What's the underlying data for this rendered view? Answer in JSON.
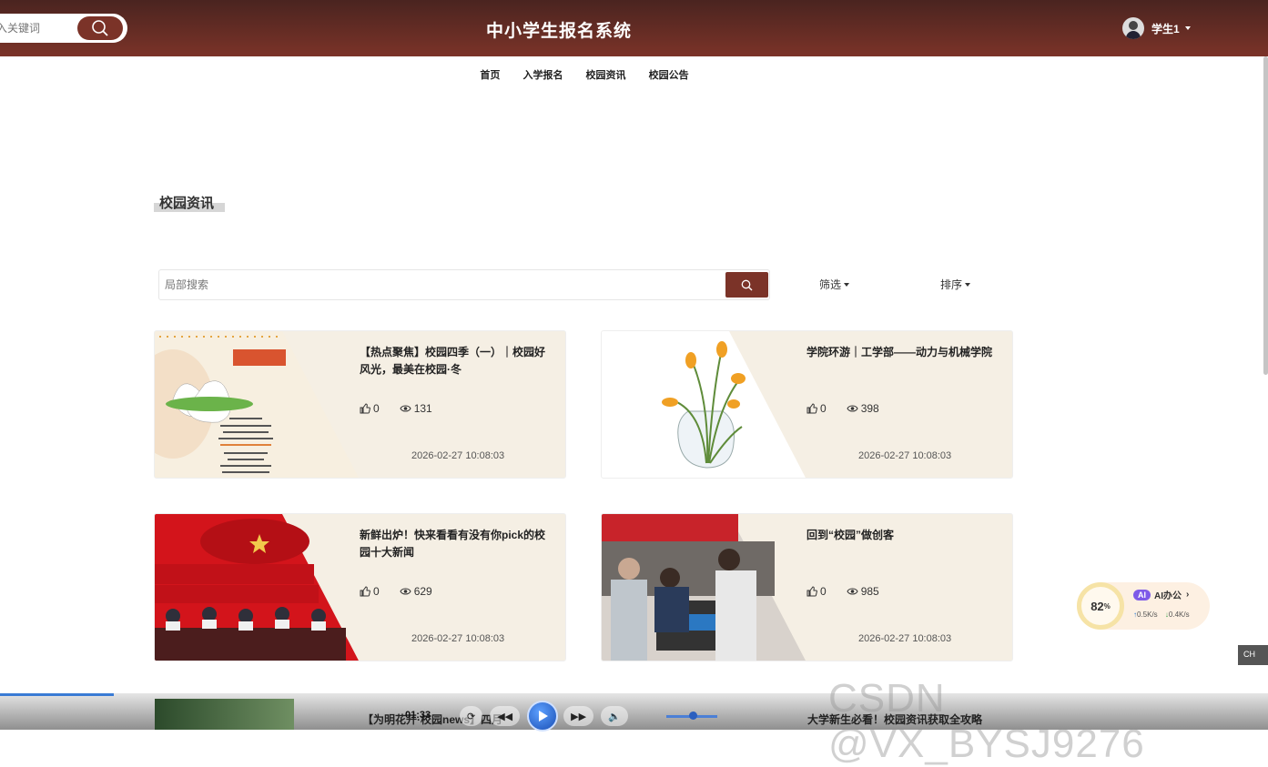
{
  "header": {
    "search_placeholder": "入关键词",
    "site_title": "中小学生报名系统",
    "user_name": "学生1"
  },
  "nav": {
    "items": [
      "首页",
      "入学报名",
      "校园资讯",
      "校园公告"
    ]
  },
  "section": {
    "title": "校园资讯",
    "search_placeholder": "局部搜索",
    "filter_label": "筛选",
    "sort_label": "排序"
  },
  "articles": [
    {
      "title": "【热点聚焦】校园四季（一）｜校园好风光，最美在校园·冬",
      "likes": "0",
      "views": "131",
      "date": "2026-02-27 10:08:03"
    },
    {
      "title": "学院环游｜工学部——动力与机械学院",
      "likes": "0",
      "views": "398",
      "date": "2026-02-27 10:08:03"
    },
    {
      "title": "新鲜出炉！快来看看有没有你pick的校园十大新闻",
      "likes": "0",
      "views": "629",
      "date": "2026-02-27 10:08:03"
    },
    {
      "title": "回到“校园”做创客",
      "likes": "0",
      "views": "985",
      "date": "2026-02-27 10:08:03"
    }
  ],
  "bottom_row": {
    "title_left": "【为明花开·校园news】四月",
    "title_right": "大学新生必看！校园资讯获取全攻略"
  },
  "overlay": {
    "player_time": "01:33",
    "widget_percent": "82",
    "widget_percent_unit": "%",
    "widget_label": "AI办公",
    "widget_ai_badge": "AI",
    "widget_up": "0.5K/s",
    "widget_down": "0.4K/s",
    "side_chip": "CH",
    "watermark": "CSDN @VX_BYSJ9276",
    "video_progress": 0.09
  },
  "colors": {
    "brand": "#7b3328",
    "card_bg": "#f5efe4"
  }
}
